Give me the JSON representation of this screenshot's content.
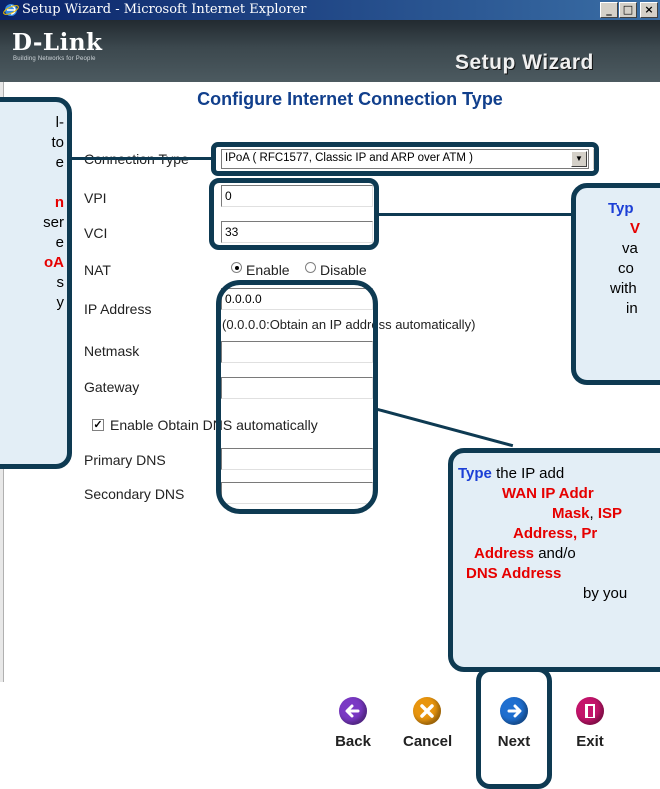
{
  "window": {
    "title": "Setup Wizard - Microsoft Internet Explorer",
    "min_glyph": "_",
    "max_glyph": "□",
    "close_glyph": "×"
  },
  "header": {
    "logo": "D-Link",
    "logo_tagline": "Building Networks for People",
    "title": "Setup Wizard"
  },
  "page_title": "Configure Internet Connection Type",
  "form": {
    "connection_type_label": "Connection Type",
    "connection_type_value": "IPoA ( RFC1577, Classic IP and ARP over ATM )",
    "vpi_label": "VPI",
    "vpi_value": "0",
    "vci_label": "VCI",
    "vci_value": "33",
    "nat_label": "NAT",
    "nat_enable": "Enable",
    "nat_disable": "Disable",
    "ip_label": "IP Address",
    "ip_value": "0.0.0.0",
    "ip_hint": "(0.0.0.0:Obtain an IP address automatically)",
    "netmask_label": "Netmask",
    "netmask_value": "",
    "gateway_label": "Gateway",
    "gateway_value": "",
    "dns_auto_label": "Enable Obtain DNS automatically",
    "dns_auto_checked": true,
    "primary_dns_label": "Primary DNS",
    "primary_dns_value": "",
    "secondary_dns_label": "Secondary DNS",
    "secondary_dns_value": ""
  },
  "callouts": {
    "left_lines": [
      "l-",
      "to",
      "e",
      "",
      "n",
      "ser",
      "e",
      "oA",
      "s",
      "y"
    ],
    "vpi_lines": [
      "Typ",
      "V",
      "va",
      "co",
      "with",
      "in"
    ],
    "ip": {
      "l1_blue": "Type",
      "l1_rest": " the IP add",
      "l2": "WAN IP Addr",
      "l3_red": "Mask",
      "l3_sep": ", ",
      "l3_red2": "ISP",
      "l4": "Address, Pr",
      "l5_red": "Address",
      "l5_rest": " and/o",
      "l6": "DNS Address",
      "l7": "by you"
    }
  },
  "nav": {
    "back": "Back",
    "cancel": "Cancel",
    "next": "Next",
    "exit": "Exit"
  },
  "colors": {
    "title_blue": "#113f8c",
    "callout_border": "#0e3a52",
    "highlight_red": "#e60000",
    "highlight_blue": "#1c3fd6",
    "back_button": "#7a39c4",
    "cancel_button": "#e8950e",
    "next_button": "#1f6fd0",
    "exit_button": "#c4146b"
  }
}
